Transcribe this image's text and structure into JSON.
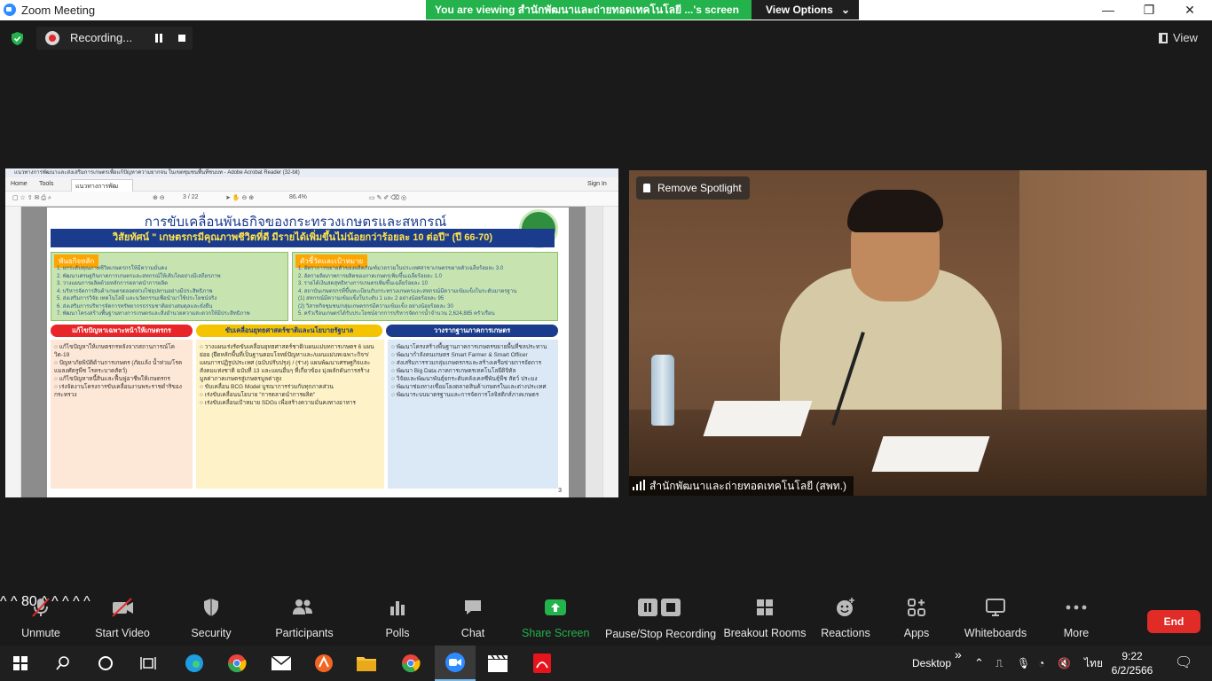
{
  "window": {
    "title": "Zoom Meeting",
    "viewing_message": "You are viewing สำนักพัฒนาและถ่ายทอดเทคโนโลยี ...'s screen",
    "view_options_label": "View Options",
    "minimize": "—",
    "restore": "❐",
    "close": "✕"
  },
  "recording": {
    "label": "Recording...",
    "view_label": "View"
  },
  "shared_screen": {
    "acrobat_title": "แนวทางการพัฒนาและส่งเสริมการเกษตรเพื่อแก้ปัญหาความยากจน ในเขตชุมชนพื้นที่ชนบท - Adobe Acrobat Reader (32-bit)",
    "tab_home": "Home",
    "tab_tools": "Tools",
    "tab_doc": "แนวทางการพัฒนาฯ...",
    "sign_in": "Sign In",
    "page_indicator": "3 / 22",
    "zoom": "86.4%",
    "slide": {
      "title": "การขับเคลื่อนพันธกิจของกระทรวงเกษตรและสหกรณ์",
      "vision": "วิสัยทัศน์ \" เกษตรกรมีคุณภาพชีวิตที่ดี มีรายได้เพิ่มขึ้นไม่น้อยกว่าร้อยละ 10 ต่อปี\" (ปี 66-70)",
      "mission_header": "พันธกิจหลัก",
      "mission_text": "1. ยกระดับคุณภาพชีวิตเกษตรกรให้มีความมั่นคง\n2. พัฒนาเศรษฐกิจภาคการเกษตรและสหกรณ์ให้เติบโตอย่างมีเสถียรภาพ\n3. วางแผนการผลิตด้วยหลักการตลาดนำการผลิต\n4. บริหารจัดการสินค้าเกษตรตลอดห่วงโซ่อุปทานอย่างมีประสิทธิภาพ\n5. ส่งเสริมการวิจัย เทคโนโลยี และนวัตกรรมเพื่อนำมาใช้ประโยชน์จริง\n6. ส่งเสริมการบริหารจัดการทรัพยากรธรรมชาติอย่างสมดุลและยั่งยืน\n7. พัฒนาโครงสร้างพื้นฐานทางการเกษตรและสิ่งอำนวยความสะดวกให้มีประสิทธิภาพ",
      "target_header": "ตัวชี้วัดและเป้าหมาย",
      "target_text": "1. อัตราการขยายตัวของผลิตภัณฑ์มวลรวมในประเทศสาขาเกษตรขยายตัวเฉลี่ยร้อยละ 3.0\n2. อัตราผลิตภาพการผลิตของภาคเกษตรเพิ่มขึ้นเฉลี่ยร้อยละ 1.0\n3. รายได้เงินสดสุทธิทางการเกษตรเพิ่มขึ้นเฉลี่ยร้อยละ 10\n4. สถาบันเกษตรกรที่ขึ้นทะเบียนกับกระทรวงเกษตรและสหกรณ์มีความเข้มแข็งในระดับมาตรฐาน\n(1) สหกรณ์มีความเข้มแข็งในระดับ 1 และ 2 อย่างน้อยร้อยละ 95\n(2) วิสาหกิจชุมชน/กลุ่มเกษตรกรมีความเข้มแข็ง อย่างน้อยร้อยละ 30\n5. ครัวเรือนเกษตรได้รับประโยชน์จากการบริหารจัดการน้ำจำนวน 2,624,885 ครัวเรือน",
      "strip1": "แก้ไขปัญหาเฉพาะหน้าให้เกษตรกร",
      "strip2": "ขับเคลื่อนยุทธศาสตร์ชาติและนโยบายรัฐบาล",
      "strip3": "วางรากฐานภาคการเกษตร",
      "col1": "○ แก้ไขปัญหาให้เกษตรกรหลังจากสถานการณ์โควิด-19\n○ ปัญหาภัยพิบัติด้านการเกษตร (ภัยแล้ง น้ำท่วม/โรคแมลงศัตรูพืช โรคระบาดสัตว์)\n○ แก้ไขปัญหาหนี้สินและฟื้นฟูอาชีพให้เกษตรกร\n○ เร่งจัดงานโครงการขับเคลื่อนงานพระราชดำริของกระทรวง",
      "col2": "○ วางแผนเร่งรัดขับเคลื่อนยุทธศาสตร์ชาติ/แผนแม่บทการเกษตร 6 แผนย่อย (ยึดหลักพื้นที่เป็นฐานตอบโจทย์ปัญหาและ/แผนแม่บทเฉพาะกิจฯ/แผนการปฏิรูปประเทศ (ฉบับปรับปรุง) / (ร่าง) แผนพัฒนาเศรษฐกิจและสังคมแห่งชาติ ฉบับที่ 13 และแผนอื่นๆ ที่เกี่ยวข้อง มุ่งผลักดันการสร้างมูลค่าภาคเกษตรสู่เกษตรมูลค่าสูง\n○ ขับเคลื่อน BCG Model บูรณาการร่วมกับทุกภาคส่วน\n○ เร่งขับเคลื่อนนโยบาย \"การตลาดนำการผลิต\"\n○ เร่งขับเคลื่อนเป้าหมาย SDGs เพื่อสร้างความมั่นคงทางอาหาร",
      "col3": "○ พัฒนาโครงสร้างพื้นฐานภาคการเกษตรขยายพื้นที่ชลประทาน\n○ พัฒนากำลังคนเกษตร Smart Farmer & Smart Officer\n○ ส่งเสริมการรวมกลุ่มเกษตรกรและสร้างเครือข่ายการจัดการ\n○ พัฒนา Big Data ภาคการเกษตรเทคโนโลยีดิจิทัล\n○ วิจัยและพัฒนาพันธุ์ยกระดับคลังเคลซีพันธุ์พืช สัตว์ ประมง\n○ พัฒนาช่องทางเชื่อมโยงตลาดสินค้าเกษตรในและต่างประเทศ\n○ พัฒนาระบบมาตรฐานและการจัดการโลจิสติกส์ภาคเกษตร",
      "page_number": "3"
    }
  },
  "video": {
    "spotlight_label": "Remove Spotlight",
    "participant_name": "สำนักพัฒนาและถ่ายทอดเทคโนโลยี (สพท.)"
  },
  "toolbar": {
    "unmute": "Unmute",
    "start_video": "Start Video",
    "security": "Security",
    "participants": "Participants",
    "participants_count": "80",
    "polls": "Polls",
    "chat": "Chat",
    "share_screen": "Share Screen",
    "pause_stop_recording": "Pause/Stop Recording",
    "breakout_rooms": "Breakout Rooms",
    "reactions": "Reactions",
    "apps": "Apps",
    "whiteboards": "Whiteboards",
    "more": "More",
    "end": "End",
    "caret": "^"
  },
  "taskbar": {
    "desktop_label": "Desktop",
    "chevron": "»",
    "lang": "ไทย",
    "time": "9:22",
    "date": "6/2/2566"
  },
  "colors": {
    "share_green": "#23b24b",
    "end_red": "#e02b27",
    "toolbar_bg": "#1a1a1a"
  }
}
